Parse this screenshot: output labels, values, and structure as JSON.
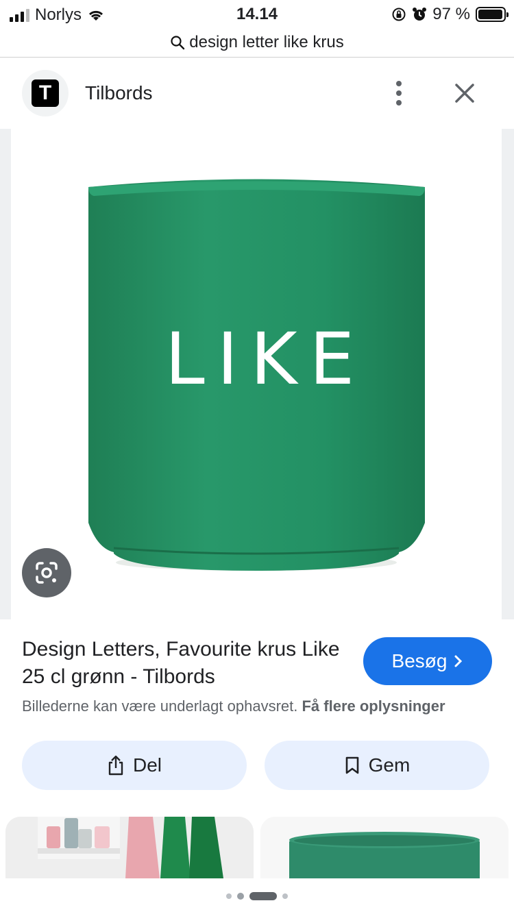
{
  "status_bar": {
    "carrier": "Norlys",
    "time": "14.14",
    "battery": "97 %",
    "battery_level": 0.97
  },
  "url_bar": {
    "search_icon": "search-icon",
    "query": "design letter like krus"
  },
  "header": {
    "logo_letter": "T",
    "site_name": "Tilbords",
    "more_icon": "more-vert-icon",
    "close_icon": "close-icon"
  },
  "image": {
    "mug_text": "LIKE",
    "mug_color": "#239164",
    "lens_icon": "google-lens-icon"
  },
  "info": {
    "title": "Design Letters, Favourite krus Like 25 cl grønn - Tilbords",
    "visit_label": "Besøg",
    "visit_icon": "chevron-right-icon",
    "copyright_text": "Billederne kan være underlagt ophavsret.",
    "more_info_link": "Få flere oplysninger",
    "accent_color": "#1a73e8"
  },
  "actions": {
    "share_label": "Del",
    "share_icon": "share-icon",
    "save_label": "Gem",
    "save_icon": "bookmark-icon"
  },
  "pagination": {
    "count": 4,
    "active_index": 2
  }
}
